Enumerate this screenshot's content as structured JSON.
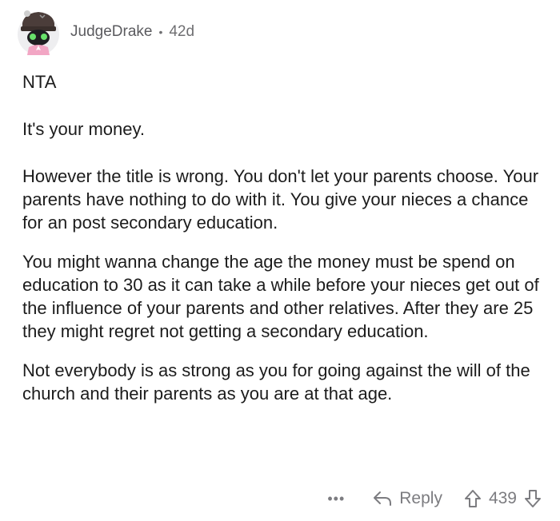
{
  "comment": {
    "username": "JudgeDrake",
    "separator": "•",
    "age": "42d",
    "paragraphs": [
      "NTA",
      "It's your money.",
      "However the title is wrong. You don't let your parents choose. Your parents have nothing to do with it. You give your nieces a chance for an post secondary education.",
      "You might wanna change the age the money must be spend on education to 30 as it can take a while before your nieces get out of the influence of your parents and other relatives. After they are 25 they might regret not getting a secondary education.",
      "Not everybody is as strong as you for going against the will of the church and their parents as you are at that age."
    ]
  },
  "actions": {
    "more": "•••",
    "reply_label": "Reply",
    "score": "439"
  },
  "icons": {
    "more": "more-icon",
    "reply": "reply-arrow-icon",
    "upvote": "upvote-arrow-icon",
    "downvote": "downvote-arrow-icon"
  },
  "colors": {
    "text": "#1c1c1c",
    "meta": "#6f6f72",
    "action": "#7c7c80"
  }
}
